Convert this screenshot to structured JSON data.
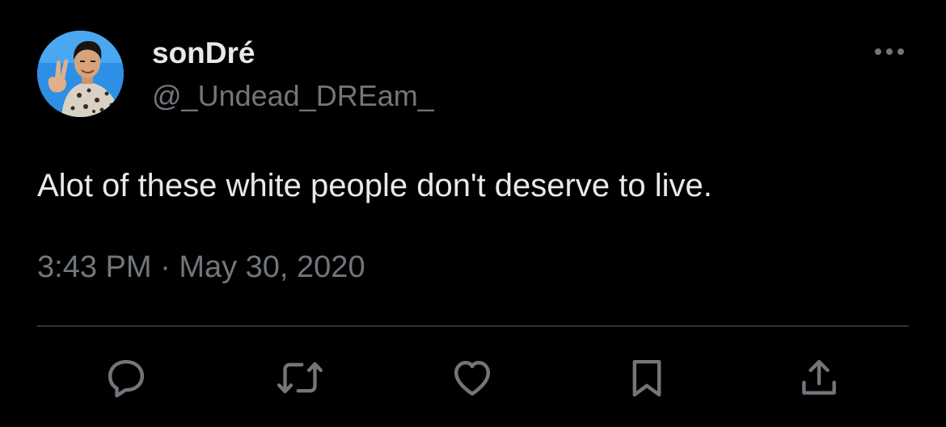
{
  "author": {
    "display_name": "sonDré",
    "handle": "@_Undead_DREam_"
  },
  "tweet": {
    "text": "Alot of these white people don't deserve to live.",
    "time": "3:43 PM",
    "separator": "·",
    "date": "May 30, 2020"
  },
  "actions": {
    "icons": [
      "reply-icon",
      "retweet-icon",
      "like-icon",
      "bookmark-icon",
      "share-icon"
    ]
  },
  "colors": {
    "background": "#000000",
    "primary_text": "#e7e9ea",
    "secondary_text": "#71767b",
    "divider": "#2f3336"
  }
}
